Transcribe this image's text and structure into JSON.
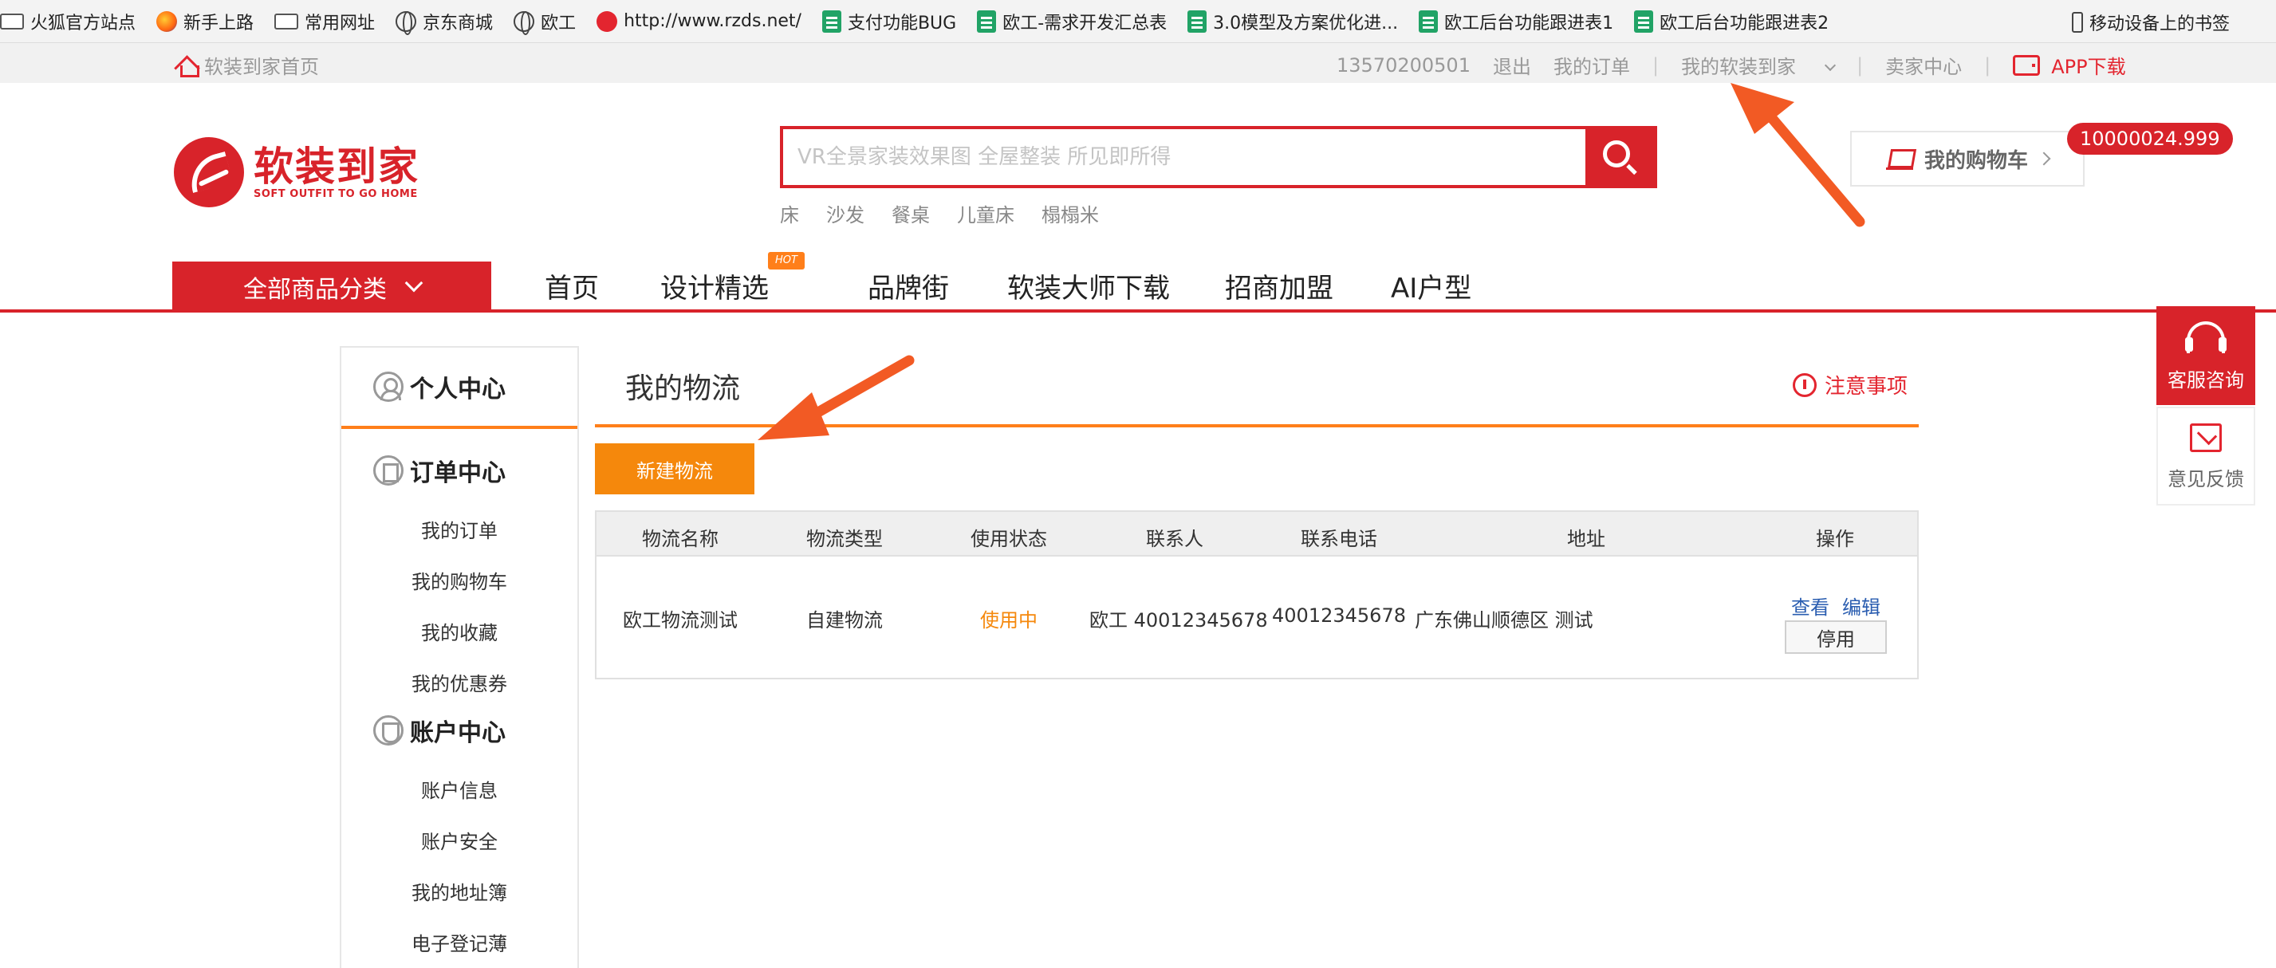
{
  "bookmarks": {
    "items": [
      {
        "label": "火狐官方站点",
        "icon": "folder-icon"
      },
      {
        "label": "新手上路",
        "icon": "firefox-icon"
      },
      {
        "label": "常用网址",
        "icon": "folder-icon"
      },
      {
        "label": "京东商城",
        "icon": "globe-icon"
      },
      {
        "label": "欧工",
        "icon": "globe-icon"
      },
      {
        "label": "http://www.rzds.net/",
        "icon": "site-logo-icon"
      },
      {
        "label": "支付功能BUG",
        "icon": "sheet-icon"
      },
      {
        "label": "欧工-需求开发汇总表",
        "icon": "sheet-icon"
      },
      {
        "label": "3.0模型及方案优化进...",
        "icon": "sheet-icon"
      },
      {
        "label": "欧工后台功能跟进表1",
        "icon": "sheet-icon"
      },
      {
        "label": "欧工后台功能跟进表2",
        "icon": "sheet-icon"
      }
    ],
    "mobile": "移动设备上的书签"
  },
  "topbar": {
    "home": "软装到家首页",
    "phone": "13570200501",
    "logout": "退出",
    "my_orders": "我的订单",
    "my_account": "我的软装到家",
    "seller": "卖家中心",
    "app": "APP下载"
  },
  "logo": {
    "cn": "软装到家",
    "en": "SOFT OUTFIT TO GO HOME"
  },
  "search": {
    "placeholder": "VR全景家装效果图 全屋整装 所见即所得",
    "hotwords": [
      "床",
      "沙发",
      "餐桌",
      "儿童床",
      "榻榻米"
    ]
  },
  "cart": {
    "label": "我的购物车",
    "badge": "10000024.999"
  },
  "nav": {
    "all_categories": "全部商品分类",
    "items": [
      "首页",
      "设计精选",
      "品牌街",
      "软装大师下载",
      "招商加盟",
      "AI户型"
    ],
    "hot_badge": "HOT"
  },
  "sidebar": {
    "title": "个人中心",
    "order_center": "订单中心",
    "order_links": [
      "我的订单",
      "我的购物车",
      "我的收藏",
      "我的优惠券"
    ],
    "account_center": "账户中心",
    "account_links": [
      "账户信息",
      "账户安全",
      "我的地址簿",
      "电子登记薄"
    ]
  },
  "main": {
    "title": "我的物流",
    "notice": "注意事项",
    "new_button": "新建物流",
    "columns": [
      "物流名称",
      "物流类型",
      "使用状态",
      "联系人",
      "联系电话",
      "地址",
      "操作"
    ],
    "rows": [
      {
        "name": "欧工物流测试",
        "type": "自建物流",
        "status": "使用中",
        "contact": "欧工 40012345678",
        "phone": "40012345678",
        "address": "广东佛山顺德区 测试",
        "view": "查看",
        "edit": "编辑",
        "disable": "停用"
      }
    ]
  },
  "float": {
    "service": "客服咨询",
    "feedback": "意见反馈"
  },
  "colors": {
    "brand_red": "#d8232a",
    "accent_orange": "#f5880c",
    "link_blue": "#2a5db0",
    "annotation_arrow": "#f25a24"
  }
}
